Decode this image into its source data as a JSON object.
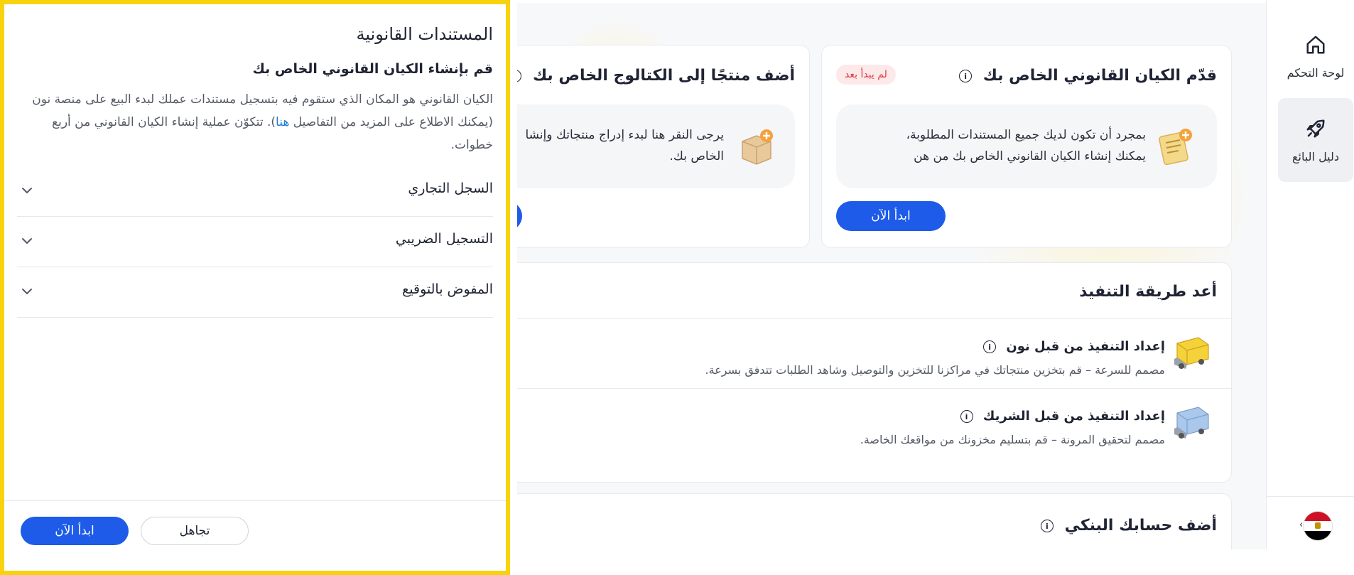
{
  "sidebar": {
    "items": [
      {
        "label": "لوحة التحكم",
        "icon": "home-icon"
      },
      {
        "label": "دليل البائع",
        "icon": "rocket-icon"
      }
    ],
    "country_flag": "egypt-flag-icon"
  },
  "legal_card": {
    "title": "قدّم الكيان القانوني الخاص بك",
    "badge": "لم يبدأ بعد",
    "text_line1": "بمجرد أن تكون لديك جميع المستندات المطلوبة،",
    "text_line2": "يمكنك إنشاء الكيان القانوني الخاص بك من هن",
    "button": "ابدأ الآن"
  },
  "catalog_card": {
    "title": "أضف منتجًا إلى الكتالوج الخاص بك",
    "text_line1": "يرجى النقر هنا لبدء إدراج منتجاتك وإنشا",
    "text_line2": "الخاص بك."
  },
  "fulfillment_card": {
    "title": "أعد طريقة التنفيذ",
    "rows": [
      {
        "title": "إعداد التنفيذ من قبل نون",
        "desc": "مصمم للسرعة – قم بتخزين منتجاتك في مراكزنا للتخزين والتوصيل وشاهد الطلبات تتدفق بسرعة."
      },
      {
        "title": "إعداد التنفيذ من قبل الشريك",
        "desc": "مصمم لتحقيق المرونة – قم بتسليم مخزونك من مواقعك الخاصة."
      }
    ]
  },
  "bank_card": {
    "title": "أضف حسابك البنكي"
  },
  "drawer": {
    "title": "المستندات القانونية",
    "subtitle": "قم بإنشاء الكيان القانوني الخاص بك",
    "body_part1": "الكيان القانوني هو المكان الذي ستقوم فيه بتسجيل مستندات عملك لبدء البيع على منصة نون (يمكنك الاطلاع على المزيد من التفاصيل ",
    "body_link": "هنا",
    "body_part2": "). تتكوّن عملية إنشاء الكيان القانوني من أربع خطوات.",
    "sections": [
      {
        "label": "السجل التجاري"
      },
      {
        "label": "التسجيل الضريبي"
      },
      {
        "label": "المفوض بالتوقيع"
      }
    ],
    "ignore_button": "تجاهل",
    "start_button": "ابدأ الآن"
  },
  "colors": {
    "primary": "#1d5be8",
    "highlight_border": "#f9d20e",
    "badge_bg": "#fde9ea",
    "badge_text": "#e0373f"
  }
}
